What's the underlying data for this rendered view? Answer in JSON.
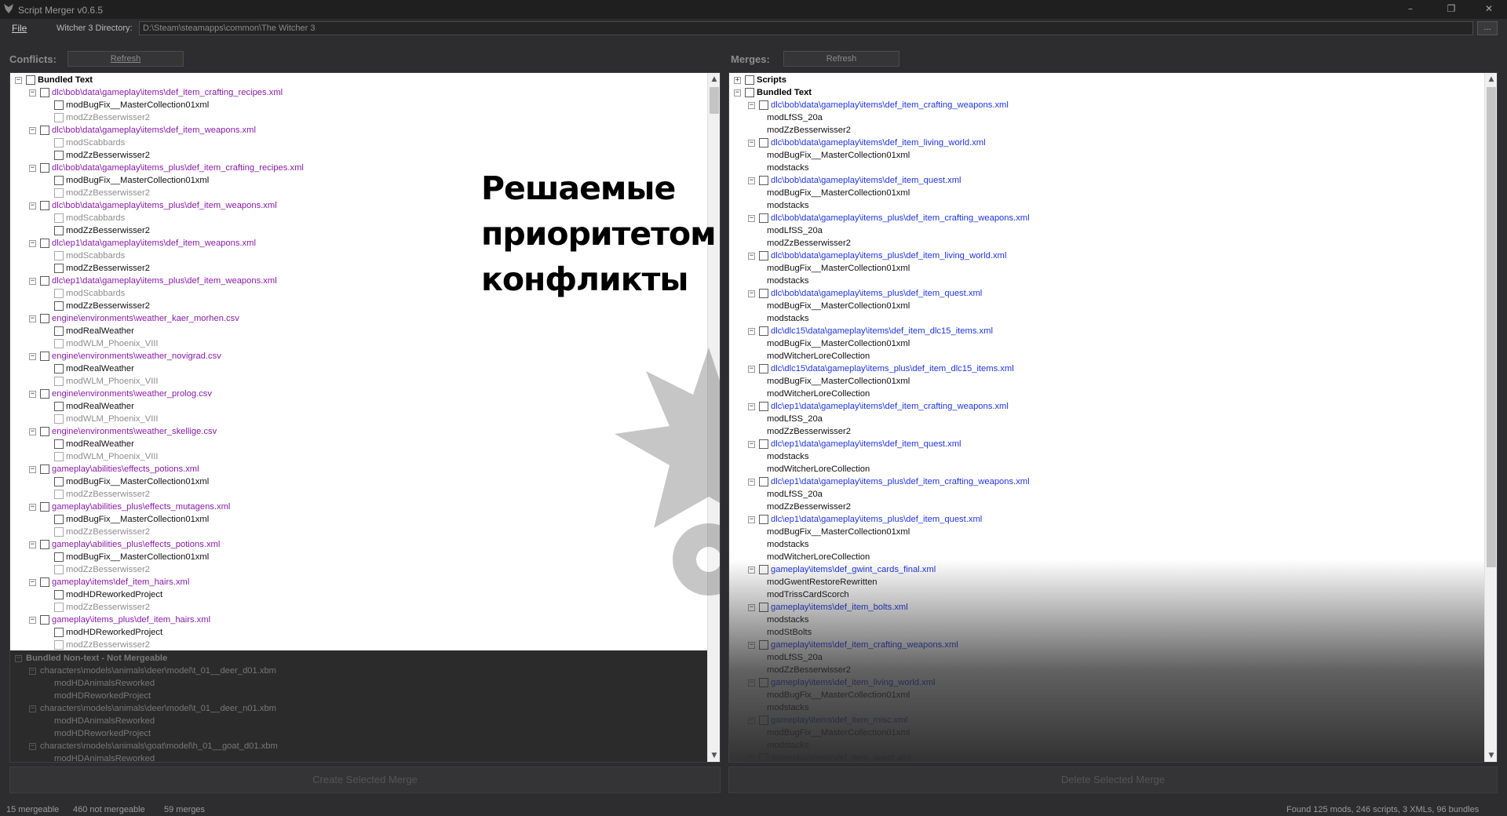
{
  "window": {
    "title": "Script Merger v0.6.5",
    "min_glyph": "–",
    "max_glyph": "❐",
    "close_glyph": "✕"
  },
  "menu": {
    "file": "File"
  },
  "directory": {
    "label": "Witcher 3 Directory:",
    "value": "D:\\Steam\\steamapps\\common\\The Witcher 3",
    "browse": "..."
  },
  "conflicts": {
    "label": "Conflicts:",
    "refresh": "Refresh",
    "rows": [
      {
        "level": 0,
        "exp": "−",
        "text": "Bundled Text",
        "style": "bold"
      },
      {
        "level": 1,
        "exp": "−",
        "text": "dlc\\bob\\data\\gameplay\\items\\def_item_crafting_recipes.xml",
        "style": "purple"
      },
      {
        "level": 2,
        "text": "modBugFix__MasterCollection01xml",
        "style": "black"
      },
      {
        "level": 2,
        "text": "modZzBesserwisser2",
        "style": "gray"
      },
      {
        "level": 1,
        "exp": "−",
        "text": "dlc\\bob\\data\\gameplay\\items\\def_item_weapons.xml",
        "style": "purple"
      },
      {
        "level": 2,
        "text": "modScabbards",
        "style": "gray"
      },
      {
        "level": 2,
        "text": "modZzBesserwisser2",
        "style": "black"
      },
      {
        "level": 1,
        "exp": "−",
        "text": "dlc\\bob\\data\\gameplay\\items_plus\\def_item_crafting_recipes.xml",
        "style": "purple"
      },
      {
        "level": 2,
        "text": "modBugFix__MasterCollection01xml",
        "style": "black"
      },
      {
        "level": 2,
        "text": "modZzBesserwisser2",
        "style": "gray"
      },
      {
        "level": 1,
        "exp": "−",
        "text": "dlc\\bob\\data\\gameplay\\items_plus\\def_item_weapons.xml",
        "style": "purple"
      },
      {
        "level": 2,
        "text": "modScabbards",
        "style": "gray"
      },
      {
        "level": 2,
        "text": "modZzBesserwisser2",
        "style": "black"
      },
      {
        "level": 1,
        "exp": "−",
        "text": "dlc\\ep1\\data\\gameplay\\items\\def_item_weapons.xml",
        "style": "purple"
      },
      {
        "level": 2,
        "text": "modScabbards",
        "style": "gray"
      },
      {
        "level": 2,
        "text": "modZzBesserwisser2",
        "style": "black"
      },
      {
        "level": 1,
        "exp": "−",
        "text": "dlc\\ep1\\data\\gameplay\\items_plus\\def_item_weapons.xml",
        "style": "purple"
      },
      {
        "level": 2,
        "text": "modScabbards",
        "style": "gray"
      },
      {
        "level": 2,
        "text": "modZzBesserwisser2",
        "style": "black"
      },
      {
        "level": 1,
        "exp": "−",
        "text": "engine\\environments\\weather_kaer_morhen.csv",
        "style": "purple"
      },
      {
        "level": 2,
        "text": "modRealWeather",
        "style": "black"
      },
      {
        "level": 2,
        "text": "modWLM_Phoenix_VIII",
        "style": "gray"
      },
      {
        "level": 1,
        "exp": "−",
        "text": "engine\\environments\\weather_novigrad.csv",
        "style": "purple"
      },
      {
        "level": 2,
        "text": "modRealWeather",
        "style": "black"
      },
      {
        "level": 2,
        "text": "modWLM_Phoenix_VIII",
        "style": "gray"
      },
      {
        "level": 1,
        "exp": "−",
        "text": "engine\\environments\\weather_prolog.csv",
        "style": "purple"
      },
      {
        "level": 2,
        "text": "modRealWeather",
        "style": "black"
      },
      {
        "level": 2,
        "text": "modWLM_Phoenix_VIII",
        "style": "gray"
      },
      {
        "level": 1,
        "exp": "−",
        "text": "engine\\environments\\weather_skellige.csv",
        "style": "purple"
      },
      {
        "level": 2,
        "text": "modRealWeather",
        "style": "black"
      },
      {
        "level": 2,
        "text": "modWLM_Phoenix_VIII",
        "style": "gray"
      },
      {
        "level": 1,
        "exp": "−",
        "text": "gameplay\\abilities\\effects_potions.xml",
        "style": "purple"
      },
      {
        "level": 2,
        "text": "modBugFix__MasterCollection01xml",
        "style": "black"
      },
      {
        "level": 2,
        "text": "modZzBesserwisser2",
        "style": "gray"
      },
      {
        "level": 1,
        "exp": "−",
        "text": "gameplay\\abilities_plus\\effects_mutagens.xml",
        "style": "purple"
      },
      {
        "level": 2,
        "text": "modBugFix__MasterCollection01xml",
        "style": "black"
      },
      {
        "level": 2,
        "text": "modZzBesserwisser2",
        "style": "gray"
      },
      {
        "level": 1,
        "exp": "−",
        "text": "gameplay\\abilities_plus\\effects_potions.xml",
        "style": "purple"
      },
      {
        "level": 2,
        "text": "modBugFix__MasterCollection01xml",
        "style": "black"
      },
      {
        "level": 2,
        "text": "modZzBesserwisser2",
        "style": "gray"
      },
      {
        "level": 1,
        "exp": "−",
        "text": "gameplay\\items\\def_item_hairs.xml",
        "style": "purple"
      },
      {
        "level": 2,
        "text": "modHDReworkedProject",
        "style": "black"
      },
      {
        "level": 2,
        "text": "modZzBesserwisser2",
        "style": "gray"
      },
      {
        "level": 1,
        "exp": "−",
        "text": "gameplay\\items_plus\\def_item_hairs.xml",
        "style": "purple"
      },
      {
        "level": 2,
        "text": "modHDReworkedProject",
        "style": "black"
      },
      {
        "level": 2,
        "text": "modZzBesserwisser2",
        "style": "gray"
      }
    ],
    "nonmerge": [
      {
        "level": 0,
        "exp": "−",
        "text": "Bundled Non-text - Not Mergeable",
        "style": "bold"
      },
      {
        "level": 1,
        "exp": "−",
        "text": "characters\\models\\animals\\deer\\model\\t_01__deer_d01.xbm"
      },
      {
        "level": 2,
        "text": "modHDAnimalsReworked"
      },
      {
        "level": 2,
        "text": "modHDReworkedProject"
      },
      {
        "level": 1,
        "exp": "−",
        "text": "characters\\models\\animals\\deer\\model\\t_01__deer_n01.xbm"
      },
      {
        "level": 2,
        "text": "modHDAnimalsReworked"
      },
      {
        "level": 2,
        "text": "modHDReworkedProject"
      },
      {
        "level": 1,
        "exp": "−",
        "text": "characters\\models\\animals\\goat\\model\\h_01__goat_d01.xbm"
      },
      {
        "level": 2,
        "text": "modHDAnimalsReworked"
      }
    ],
    "overlay": [
      "Решаемые",
      "приоритетом",
      "конфликты"
    ],
    "action": "Create Selected Merge"
  },
  "merges": {
    "label": "Merges:",
    "refresh": "Refresh",
    "rows": [
      {
        "level": 0,
        "exp": "+",
        "text": "Scripts",
        "style": "bold"
      },
      {
        "level": 0,
        "exp": "−",
        "text": "Bundled Text",
        "style": "bold"
      },
      {
        "level": 1,
        "exp": "−",
        "text": "dlc\\bob\\data\\gameplay\\items\\def_item_crafting_weapons.xml",
        "style": "blue"
      },
      {
        "level": 2,
        "text": "modLfSS_20a",
        "style": "black"
      },
      {
        "level": 2,
        "text": "modZzBesserwisser2",
        "style": "black"
      },
      {
        "level": 1,
        "exp": "−",
        "text": "dlc\\bob\\data\\gameplay\\items\\def_item_living_world.xml",
        "style": "blue"
      },
      {
        "level": 2,
        "text": "modBugFix__MasterCollection01xml",
        "style": "black"
      },
      {
        "level": 2,
        "text": "modstacks",
        "style": "black"
      },
      {
        "level": 1,
        "exp": "−",
        "text": "dlc\\bob\\data\\gameplay\\items\\def_item_quest.xml",
        "style": "blue"
      },
      {
        "level": 2,
        "text": "modBugFix__MasterCollection01xml",
        "style": "black"
      },
      {
        "level": 2,
        "text": "modstacks",
        "style": "black"
      },
      {
        "level": 1,
        "exp": "−",
        "text": "dlc\\bob\\data\\gameplay\\items_plus\\def_item_crafting_weapons.xml",
        "style": "blue"
      },
      {
        "level": 2,
        "text": "modLfSS_20a",
        "style": "black"
      },
      {
        "level": 2,
        "text": "modZzBesserwisser2",
        "style": "black"
      },
      {
        "level": 1,
        "exp": "−",
        "text": "dlc\\bob\\data\\gameplay\\items_plus\\def_item_living_world.xml",
        "style": "blue"
      },
      {
        "level": 2,
        "text": "modBugFix__MasterCollection01xml",
        "style": "black"
      },
      {
        "level": 2,
        "text": "modstacks",
        "style": "black"
      },
      {
        "level": 1,
        "exp": "−",
        "text": "dlc\\bob\\data\\gameplay\\items_plus\\def_item_quest.xml",
        "style": "blue"
      },
      {
        "level": 2,
        "text": "modBugFix__MasterCollection01xml",
        "style": "black"
      },
      {
        "level": 2,
        "text": "modstacks",
        "style": "black"
      },
      {
        "level": 1,
        "exp": "−",
        "text": "dlc\\dlc15\\data\\gameplay\\items\\def_item_dlc15_items.xml",
        "style": "blue"
      },
      {
        "level": 2,
        "text": "modBugFix__MasterCollection01xml",
        "style": "black"
      },
      {
        "level": 2,
        "text": "modWitcherLoreCollection",
        "style": "black"
      },
      {
        "level": 1,
        "exp": "−",
        "text": "dlc\\dlc15\\data\\gameplay\\items_plus\\def_item_dlc15_items.xml",
        "style": "blue"
      },
      {
        "level": 2,
        "text": "modBugFix__MasterCollection01xml",
        "style": "black"
      },
      {
        "level": 2,
        "text": "modWitcherLoreCollection",
        "style": "black"
      },
      {
        "level": 1,
        "exp": "−",
        "text": "dlc\\ep1\\data\\gameplay\\items\\def_item_crafting_weapons.xml",
        "style": "blue"
      },
      {
        "level": 2,
        "text": "modLfSS_20a",
        "style": "black"
      },
      {
        "level": 2,
        "text": "modZzBesserwisser2",
        "style": "black"
      },
      {
        "level": 1,
        "exp": "−",
        "text": "dlc\\ep1\\data\\gameplay\\items\\def_item_quest.xml",
        "style": "blue"
      },
      {
        "level": 2,
        "text": "modstacks",
        "style": "black"
      },
      {
        "level": 2,
        "text": "modWitcherLoreCollection",
        "style": "black"
      },
      {
        "level": 1,
        "exp": "−",
        "text": "dlc\\ep1\\data\\gameplay\\items_plus\\def_item_crafting_weapons.xml",
        "style": "blue"
      },
      {
        "level": 2,
        "text": "modLfSS_20a",
        "style": "black"
      },
      {
        "level": 2,
        "text": "modZzBesserwisser2",
        "style": "black"
      },
      {
        "level": 1,
        "exp": "−",
        "text": "dlc\\ep1\\data\\gameplay\\items_plus\\def_item_quest.xml",
        "style": "blue"
      },
      {
        "level": 2,
        "text": "modBugFix__MasterCollection01xml",
        "style": "black"
      },
      {
        "level": 2,
        "text": "modstacks",
        "style": "black"
      },
      {
        "level": 2,
        "text": "modWitcherLoreCollection",
        "style": "black"
      },
      {
        "level": 1,
        "exp": "−",
        "text": "gameplay\\items\\def_gwint_cards_final.xml",
        "style": "blue"
      },
      {
        "level": 2,
        "text": "modGwentRestoreRewritten",
        "style": "black"
      },
      {
        "level": 2,
        "text": "modTrissCardScorch",
        "style": "black"
      },
      {
        "level": 1,
        "exp": "−",
        "text": "gameplay\\items\\def_item_bolts.xml",
        "style": "blue"
      },
      {
        "level": 2,
        "text": "modstacks",
        "style": "black"
      },
      {
        "level": 2,
        "text": "modStBolts",
        "style": "black"
      },
      {
        "level": 1,
        "exp": "−",
        "text": "gameplay\\items\\def_item_crafting_weapons.xml",
        "style": "blue"
      },
      {
        "level": 2,
        "text": "modLfSS_20a",
        "style": "black"
      },
      {
        "level": 2,
        "text": "modZzBesserwisser2",
        "style": "black"
      },
      {
        "level": 1,
        "exp": "−",
        "text": "gameplay\\items\\def_item_living_world.xml",
        "style": "blue"
      },
      {
        "level": 2,
        "text": "modBugFix__MasterCollection01xml",
        "style": "black"
      },
      {
        "level": 2,
        "text": "modstacks",
        "style": "black"
      },
      {
        "level": 1,
        "exp": "−",
        "text": "gameplay\\items\\def_item_misc.xml",
        "style": "blue"
      },
      {
        "level": 2,
        "text": "modBugFix__MasterCollection01xml",
        "style": "black"
      },
      {
        "level": 2,
        "text": "modstacks",
        "style": "black"
      },
      {
        "level": 1,
        "exp": "−",
        "text": "gameplay\\items\\def_item_quest.xml",
        "style": "blue"
      }
    ],
    "action": "Delete Selected Merge"
  },
  "status": {
    "mergeable": "15 mergeable",
    "not_mergeable": "460 not mergeable",
    "merges": "59 merges",
    "summary": "Found 125 mods, 246 scripts, 3 XMLs, 96 bundles"
  },
  "colors": {
    "conflict_path": "#8a1aa8",
    "merge_path": "#1f34e0",
    "inactive_mod": "#8d8d8d",
    "background": "#2d2d30"
  }
}
